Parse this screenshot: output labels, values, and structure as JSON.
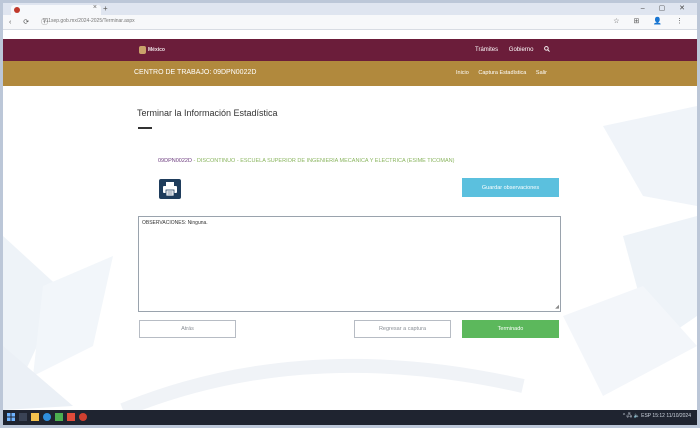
{
  "browser": {
    "url": "911sep.gob.mx/2024-2025/Terminar.aspx",
    "nav_icons": "‹ ⟳ ⓘ",
    "right_icons": "☆ ⊞ 👤 ⋮",
    "window_controls": "– ▢ ✕",
    "tab_close": "×",
    "new_tab": "+"
  },
  "header": {
    "logo_text": "México",
    "links": [
      "Trámites",
      "Gobierno"
    ],
    "search_icon": "search-icon"
  },
  "subheader": {
    "title": "CENTRO DE TRABAJO: 09DPN0022D",
    "links": [
      "Inicio",
      "Captura Estadística",
      "Salir"
    ]
  },
  "main": {
    "page_title": "Terminar la Información Estadística",
    "school": {
      "code": "09DPN0022D",
      "separator1": " - ",
      "type": "DISCONTINUO",
      "separator2": " - ",
      "name": "ESCUELA SUPERIOR DE INGENIERIA MECANICA Y ELECTRICA (ESIME TICOMAN)"
    },
    "print_icon": "printer-icon",
    "save_observations_label": "Guardar observaciones",
    "observations_text": "OBSERVACIONES: Ninguna.",
    "resize_glyph": "◢",
    "buttons": {
      "back": "Atrás",
      "return": "Regresar a captura",
      "done": "Terminado"
    }
  },
  "taskbar": {
    "tray_text": "^ 🖧 🔈 ESP  15:12  11/10/2024"
  },
  "colors": {
    "top_nav": "#6b1d3a",
    "sub_nav": "#b1893d",
    "save_button": "#5bc0de",
    "done_button": "#5cb85c",
    "code_text": "#6b3a7d",
    "school_text": "#8ab55f"
  }
}
